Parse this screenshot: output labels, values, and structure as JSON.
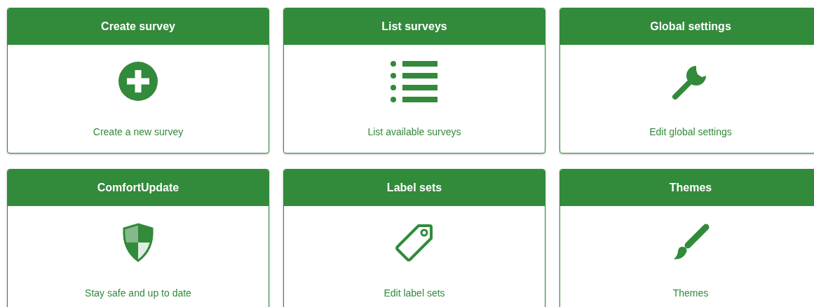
{
  "cards": [
    {
      "title": "Create survey",
      "description": "Create a new survey"
    },
    {
      "title": "List surveys",
      "description": "List available surveys"
    },
    {
      "title": "Global settings",
      "description": "Edit global settings"
    },
    {
      "title": "ComfortUpdate",
      "description": "Stay safe and up to date"
    },
    {
      "title": "Label sets",
      "description": "Edit label sets"
    },
    {
      "title": "Themes",
      "description": "Themes"
    }
  ]
}
